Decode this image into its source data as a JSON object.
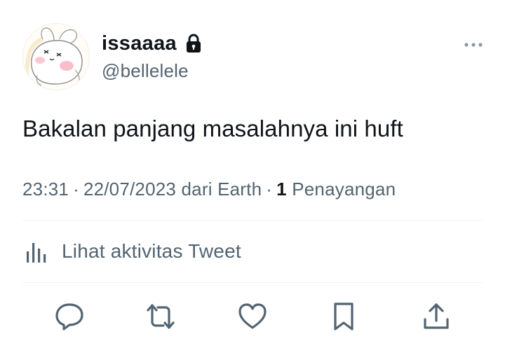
{
  "tweet": {
    "author": {
      "display_name": "issaaaa",
      "handle": "@bellelele",
      "protected": true
    },
    "text": "Bakalan panjang masalahnya ini huft",
    "time": "23:31",
    "date": "22/07/2023",
    "source": "dari Earth",
    "views_count": "1",
    "views_label": "Penayangan",
    "separator": "·",
    "activity_label": "Lihat aktivitas Tweet"
  },
  "icons": {
    "lock": "lock-icon",
    "more": "more-horizontal-icon",
    "activity": "analytics-bar-icon",
    "reply": "reply-icon",
    "retweet": "retweet-icon",
    "like": "heart-icon",
    "bookmark": "bookmark-icon",
    "share": "share-icon"
  },
  "colors": {
    "text_primary": "#0f1419",
    "text_secondary": "#536471",
    "divider": "#eff3f4"
  }
}
